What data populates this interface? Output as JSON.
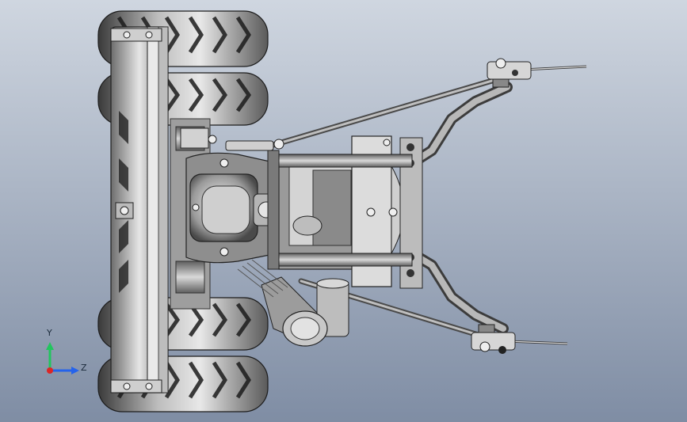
{
  "viewport": {
    "background_top": "#cfd6e0",
    "background_bottom": "#7f8da4"
  },
  "triad": {
    "y_label": "Y",
    "z_label": "Z",
    "y_color": "#22c55e",
    "z_color": "#2563eb",
    "x_color": "#dc2626"
  }
}
